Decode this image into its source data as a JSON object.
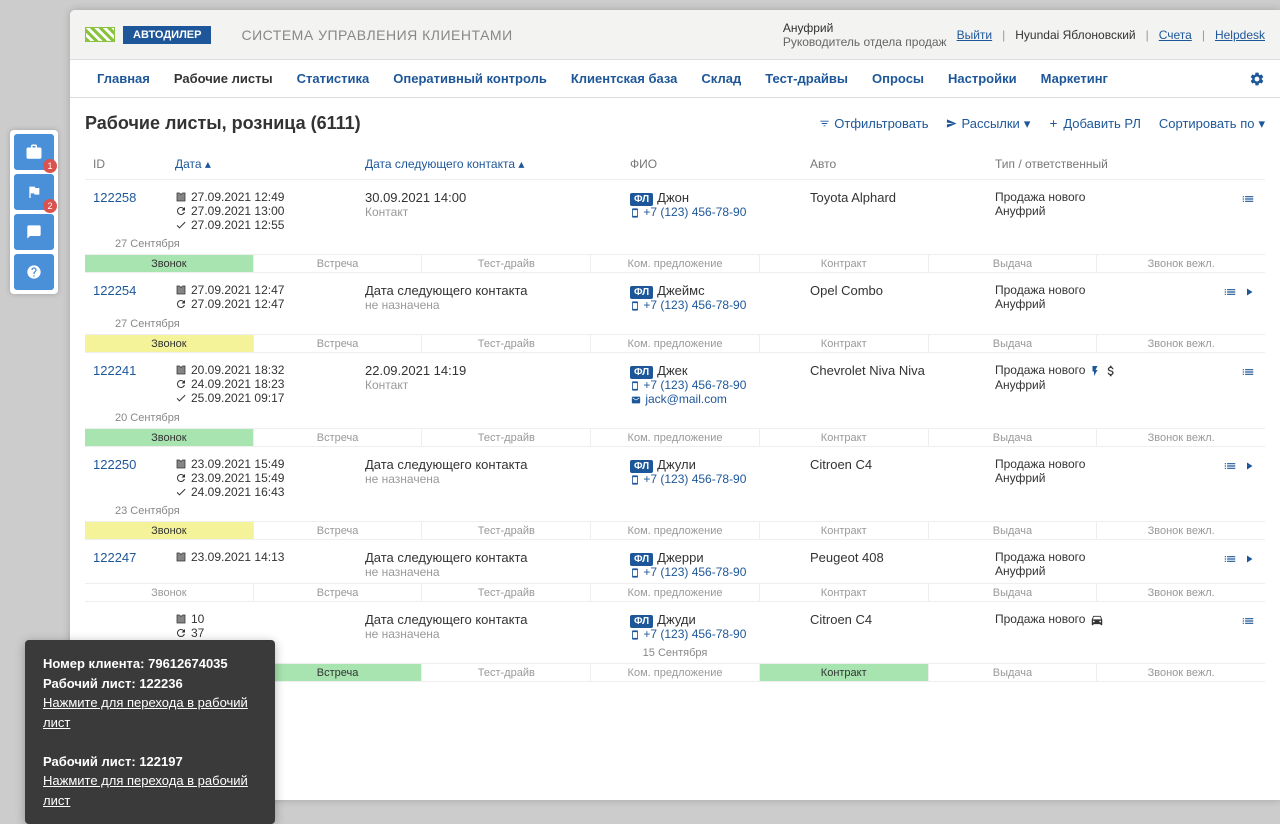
{
  "logo_badge": "АВТОДИЛЕР",
  "system_title": "СИСТЕМА УПРАВЛЕНИЯ КЛИЕНТАМИ",
  "user": {
    "name": "Ануфрий",
    "role": "Руководитель отдела продаж"
  },
  "header_links": {
    "logout": "Выйти",
    "dealer": "Hyundai Яблоновский",
    "accounts": "Счета",
    "helpdesk": "Helpdesk"
  },
  "nav": [
    "Главная",
    "Рабочие листы",
    "Статистика",
    "Оперативный контроль",
    "Клиентская база",
    "Склад",
    "Тест-драйвы",
    "Опросы",
    "Настройки",
    "Маркетинг"
  ],
  "nav_active_index": 1,
  "page_title": "Рабочие листы, розница (6111)",
  "actions": {
    "filter": "Отфильтровать",
    "mailings": "Рассылки",
    "add": "Добавить РЛ",
    "sort": "Сортировать по"
  },
  "columns": {
    "id": "ID",
    "date": "Дата",
    "next": "Дата следующего контакта",
    "fio": "ФИО",
    "auto": "Авто",
    "type": "Тип / ответственный"
  },
  "stages_labels": [
    "Звонок",
    "Встреча",
    "Тест-драйв",
    "Ком. предложение",
    "Контракт",
    "Выдача",
    "Звонок вежл."
  ],
  "no_next": {
    "line1": "Дата следующего контакта",
    "line2": "не назначена"
  },
  "contact_label": "Контакт",
  "fl_label": "ФЛ",
  "side_badges": {
    "briefcase": "1",
    "flag": "2"
  },
  "rows": [
    {
      "id": "122258",
      "dates": [
        {
          "icon": "in",
          "text": "27.09.2021 12:49"
        },
        {
          "icon": "refresh",
          "text": "27.09.2021 13:00"
        },
        {
          "icon": "check",
          "text": "27.09.2021 12:55"
        }
      ],
      "next_date": "30.09.2021 14:00",
      "has_next": true,
      "name": "Джон",
      "phone": "+7 (123) 456-78-90",
      "auto": "Toyota Alphard",
      "type": "Продажа нового",
      "resp": "Ануфрий",
      "sep": "27 Сентября",
      "sep_pos": "left",
      "stage_colors": [
        "green",
        "",
        "",
        "",
        "",
        "",
        ""
      ],
      "actions": [
        "list"
      ],
      "ext": []
    },
    {
      "id": "122254",
      "dates": [
        {
          "icon": "in",
          "text": "27.09.2021 12:47"
        },
        {
          "icon": "refresh",
          "text": "27.09.2021 12:47"
        }
      ],
      "has_next": false,
      "name": "Джеймс",
      "phone": "+7 (123) 456-78-90",
      "auto": "Opel Combo",
      "type": "Продажа нового",
      "resp": "Ануфрий",
      "sep": "27 Сентября",
      "sep_pos": "left",
      "stage_colors": [
        "yellow",
        "",
        "",
        "",
        "",
        "",
        ""
      ],
      "actions": [
        "list",
        "play"
      ],
      "ext": []
    },
    {
      "id": "122241",
      "dates": [
        {
          "icon": "in",
          "text": "20.09.2021 18:32"
        },
        {
          "icon": "refresh",
          "text": "24.09.2021 18:23"
        },
        {
          "icon": "check",
          "text": "25.09.2021 09:17"
        }
      ],
      "next_date": "22.09.2021 14:19",
      "has_next": true,
      "name": "Джек",
      "phone": "+7 (123) 456-78-90",
      "email": "jack@mail.com",
      "auto": "Chevrolet Niva Niva",
      "type": "Продажа нового",
      "resp": "Ануфрий",
      "sep": "20 Сентября",
      "sep_pos": "left",
      "stage_colors": [
        "green",
        "",
        "",
        "",
        "",
        "",
        ""
      ],
      "actions": [
        "list"
      ],
      "ext": [
        "bolt",
        "dollar"
      ]
    },
    {
      "id": "122250",
      "dates": [
        {
          "icon": "in",
          "text": "23.09.2021 15:49"
        },
        {
          "icon": "refresh",
          "text": "23.09.2021 15:49"
        },
        {
          "icon": "check",
          "text": "24.09.2021 16:43"
        }
      ],
      "has_next": false,
      "name": "Джули",
      "phone": "+7 (123) 456-78-90",
      "auto": "Citroen C4",
      "type": "Продажа нового",
      "resp": "Ануфрий",
      "sep": "23 Сентября",
      "sep_pos": "left",
      "stage_colors": [
        "yellow",
        "",
        "",
        "",
        "",
        "",
        ""
      ],
      "actions": [
        "list",
        "play"
      ],
      "ext": []
    },
    {
      "id": "122247",
      "dates": [
        {
          "icon": "in",
          "text": "23.09.2021 14:13"
        },
        {
          "icon": "refresh",
          "text": "",
          "hidden": true
        },
        {
          "icon": "check",
          "text": "",
          "hidden": true
        }
      ],
      "has_next": false,
      "name": "Джерри",
      "phone": "+7 (123) 456-78-90",
      "auto": "Peugeot 408",
      "type": "Продажа нового",
      "resp": "Ануфрий",
      "sep": "",
      "stage_colors": [
        "",
        "",
        "",
        "",
        "",
        "",
        ""
      ],
      "actions": [
        "list",
        "play"
      ],
      "ext": []
    },
    {
      "id": "",
      "dates": [
        {
          "icon": "in",
          "text": "10"
        },
        {
          "icon": "refresh",
          "text": "37"
        }
      ],
      "has_next": false,
      "name": "Джуди",
      "phone": "+7 (123) 456-78-90",
      "auto": "Citroen C4",
      "type": "Продажа нового",
      "resp": "",
      "sep": "15 Сентября",
      "sep_pos": "center",
      "stage_colors": [
        "green",
        "green",
        "",
        "",
        "green",
        "",
        ""
      ],
      "actions": [
        "list"
      ],
      "ext": [
        "car"
      ]
    }
  ],
  "tooltip": {
    "client_label": "Номер клиента:",
    "client_num": "79612674035",
    "sheet_label": "Рабочий лист:",
    "sheet1": "122236",
    "link": "Нажмите для перехода в рабочий лист",
    "sheet2": "122197"
  }
}
